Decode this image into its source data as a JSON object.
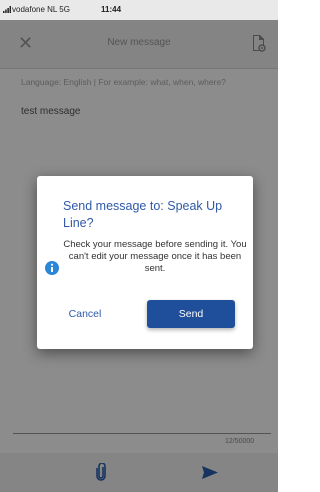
{
  "status_bar": {
    "carrier": "vodafone NL  5G",
    "time": "11:44"
  },
  "app_bar": {
    "title": "New message",
    "close_icon": "close-icon",
    "document_icon": "document-settings-icon"
  },
  "compose": {
    "hint": "Language: English | For example: what, when, where?",
    "message": "test message",
    "counter": "12/50000"
  },
  "bottom_bar": {
    "attach_icon": "paperclip-icon",
    "send_icon": "send-icon"
  },
  "dialog": {
    "title": "Send message to: Speak Up Line?",
    "body": "Check your message before sending it. You can't edit your message once it has been sent.",
    "cancel_label": "Cancel",
    "send_label": "Send"
  },
  "colors": {
    "accent": "#1f4f9a",
    "title_blue": "#2f5aa8",
    "info_blue": "#2a86d6"
  }
}
